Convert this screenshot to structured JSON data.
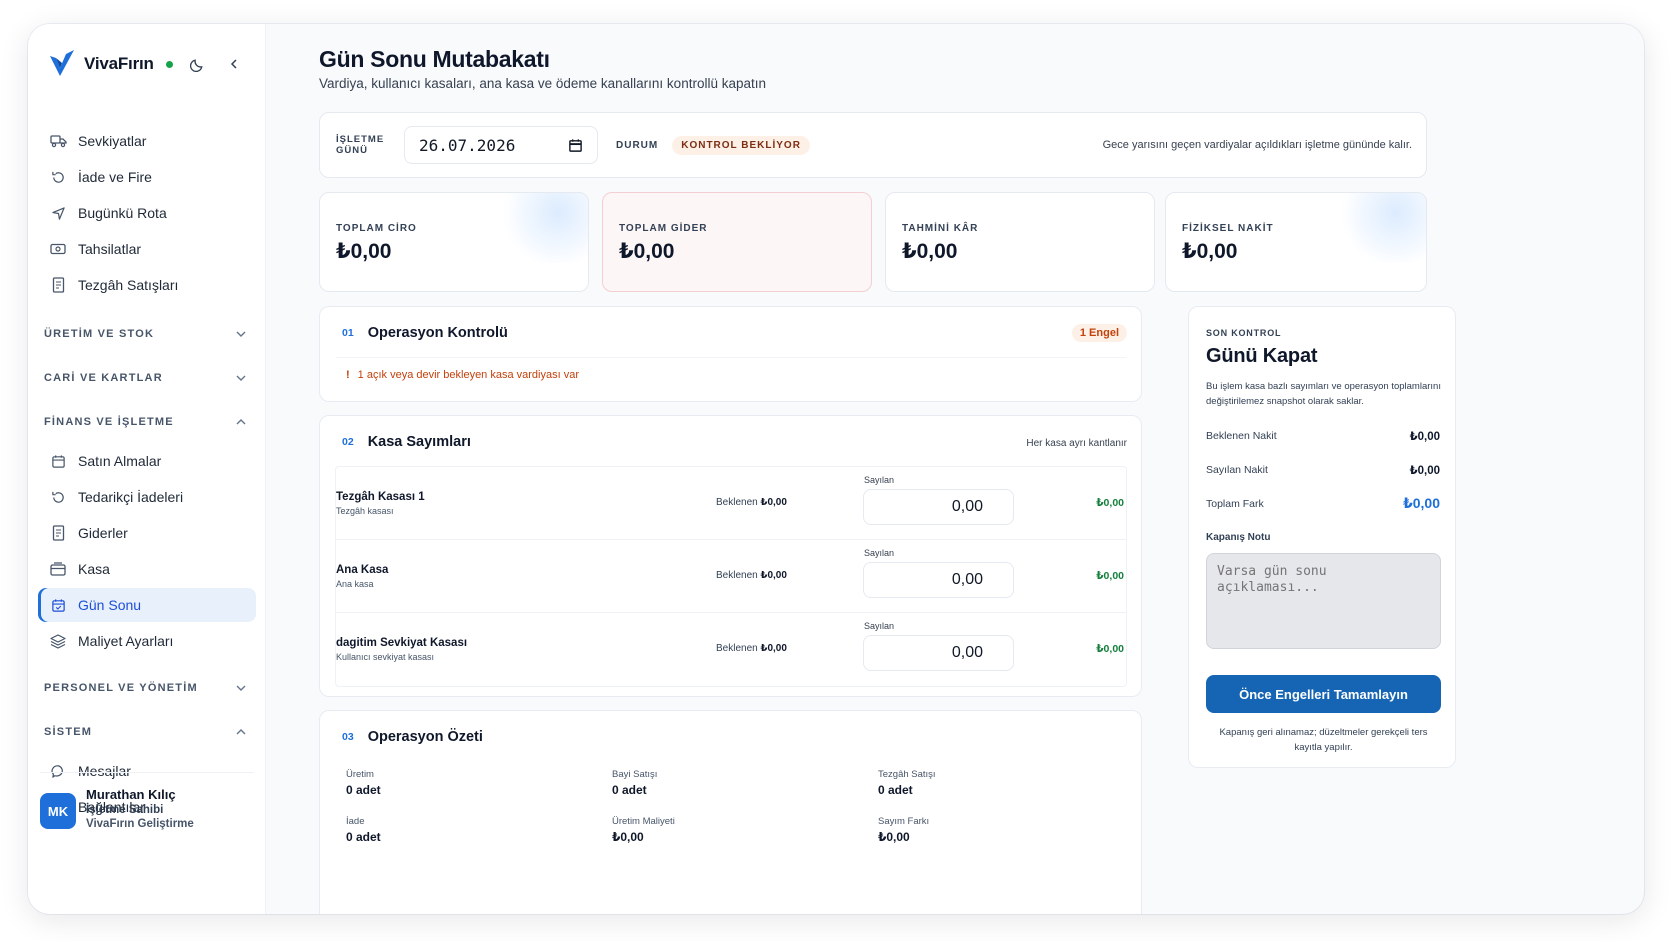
{
  "brand": {
    "name": "VivaFırın"
  },
  "nav": {
    "top_items": [
      {
        "label": "Sevkiyatlar",
        "icon": "truck-icon"
      },
      {
        "label": "İade ve Fire",
        "icon": "return-icon"
      },
      {
        "label": "Bugünkü Rota",
        "icon": "navigation-icon"
      },
      {
        "label": "Tahsilatlar",
        "icon": "cash-icon"
      },
      {
        "label": "Tezgâh Satışları",
        "icon": "receipt-icon"
      }
    ],
    "sections": {
      "uretim": "ÜRETİM VE STOK",
      "cari": "CARİ VE KARTLAR",
      "finans": "FİNANS VE İŞLETME",
      "personel": "PERSONEL VE YÖNETİM",
      "sistem": "SİSTEM"
    },
    "finans_items": [
      {
        "label": "Satın Almalar",
        "icon": "calendar-icon"
      },
      {
        "label": "Tedarikçi İadeleri",
        "icon": "return-icon"
      },
      {
        "label": "Giderler",
        "icon": "receipt-icon"
      },
      {
        "label": "Kasa",
        "icon": "cashbox-icon"
      },
      {
        "label": "Gün Sonu",
        "icon": "calendar-check-icon",
        "active": true
      },
      {
        "label": "Maliyet Ayarları",
        "icon": "layers-icon"
      }
    ],
    "sistem_items": [
      {
        "label": "Mesajlar",
        "icon": "message-icon"
      },
      {
        "label": "Bağlantılar",
        "icon": "plug-icon"
      }
    ]
  },
  "user": {
    "initials": "MK",
    "name": "Murathan Kılıç",
    "role": "İşletme Sahibi",
    "org": "VivaFırın Geliştirme"
  },
  "page": {
    "title": "Gün Sonu Mutabakatı",
    "subtitle": "Vardiya, kullanıcı kasaları, ana kasa ve ödeme kanallarını kontrollü kapatın"
  },
  "filter": {
    "date_label": "İŞLETME GÜNÜ",
    "date_value": "26.07.2026",
    "status_label": "DURUM",
    "status_value": "KONTROL BEKLİYOR",
    "note": "Gece yarısını geçen vardiyalar açıldıkları işletme gününde kalır."
  },
  "stats": [
    {
      "label": "TOPLAM CİRO",
      "value": "₺0,00"
    },
    {
      "label": "TOPLAM GİDER",
      "value": "₺0,00"
    },
    {
      "label": "TAHMİNİ KÂR",
      "value": "₺0,00"
    },
    {
      "label": "FİZİKSEL NAKİT",
      "value": "₺0,00"
    }
  ],
  "operasyon": {
    "no": "01",
    "title": "Operasyon Kontrolü",
    "badge": "1 Engel",
    "alerts": [
      "1 açık veya devir bekleyen kasa vardiyası var"
    ]
  },
  "kasa": {
    "no": "02",
    "title": "Kasa Sayımları",
    "note": "Her kasa ayrı kantlanır",
    "counted_label": "Sayılan",
    "expected_prefix": "Beklenen",
    "rows": [
      {
        "name": "Tezgâh Kasası 1",
        "desc": "Tezgâh kasası",
        "expected": "₺0,00",
        "counted": "0,00",
        "diff": "₺0,00"
      },
      {
        "name": "Ana Kasa",
        "desc": "Ana kasa",
        "expected": "₺0,00",
        "counted": "0,00",
        "diff": "₺0,00"
      },
      {
        "name": "dagitim Sevkiyat Kasası",
        "desc": "Kullanıcı sevkiyat kasası",
        "expected": "₺0,00",
        "counted": "0,00",
        "diff": "₺0,00"
      }
    ]
  },
  "ozet": {
    "no": "03",
    "title": "Operasyon Özeti",
    "items": [
      {
        "label": "Üretim",
        "value": "0 adet"
      },
      {
        "label": "Bayi Satışı",
        "value": "0 adet"
      },
      {
        "label": "Tezgâh Satışı",
        "value": "0 adet"
      },
      {
        "label": "İade",
        "value": "0 adet"
      },
      {
        "label": "Üretim Maliyeti",
        "value": "₺0,00"
      },
      {
        "label": "Sayım Farkı",
        "value": "₺0,00"
      }
    ]
  },
  "close": {
    "kicker": "SON KONTROL",
    "title": "Günü Kapat",
    "desc": "Bu işlem kasa bazlı sayımları ve operasyon toplamlarını değiştirilemez snapshot olarak saklar.",
    "rows": [
      {
        "label": "Beklenen Nakit",
        "value": "₺0,00"
      },
      {
        "label": "Sayılan Nakit",
        "value": "₺0,00"
      },
      {
        "label": "Toplam Fark",
        "value": "₺0,00"
      }
    ],
    "note_label": "Kapanış Notu",
    "note_placeholder": "Varsa gün sonu açıklaması...",
    "button": "Önce Engelleri Tamamlayın",
    "footer": "Kapanış geri alınamaz; düzeltmeler gerekçeli ters kayıtla yapılır."
  },
  "colors": {
    "accent": "#1e6fd9",
    "button": "#1565b4",
    "success": "#15803d",
    "warning": "#c2410c",
    "online": "#16a34a"
  }
}
